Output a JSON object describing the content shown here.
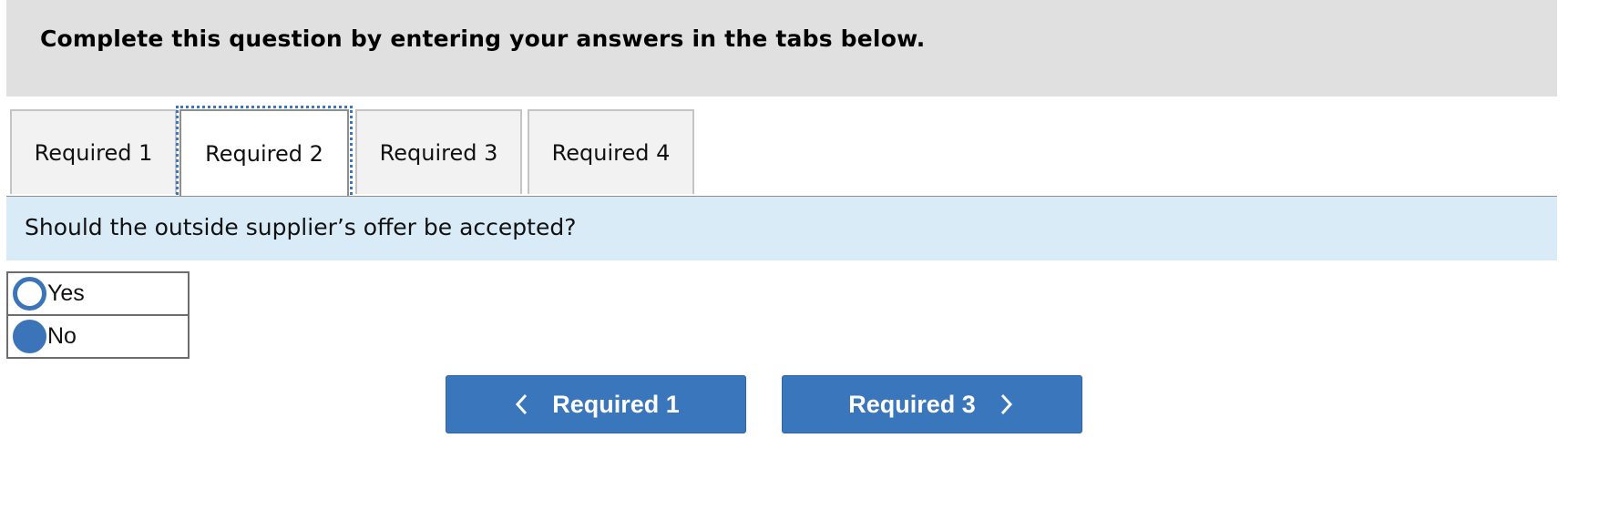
{
  "header": {
    "instruction": "Complete this question by entering your answers in the tabs below."
  },
  "tabs": [
    {
      "label": "Required 1",
      "active": false
    },
    {
      "label": "Required 2",
      "active": true
    },
    {
      "label": "Required 3",
      "active": false
    },
    {
      "label": "Required 4",
      "active": false
    }
  ],
  "question": {
    "text": "Should the outside supplier’s offer be accepted?"
  },
  "options": [
    {
      "label": "Yes",
      "selected": false
    },
    {
      "label": "No",
      "selected": true
    }
  ],
  "navigation": {
    "prev_label": "Required 1",
    "prev_icon": "chevron-left-icon",
    "next_label": "Required 3",
    "next_icon": "chevron-right-icon"
  },
  "colors": {
    "accent": "#3a76bb",
    "header_bg": "#e0e0e0",
    "question_bg": "#daebf8",
    "focus_outline": "#3a77c0"
  }
}
